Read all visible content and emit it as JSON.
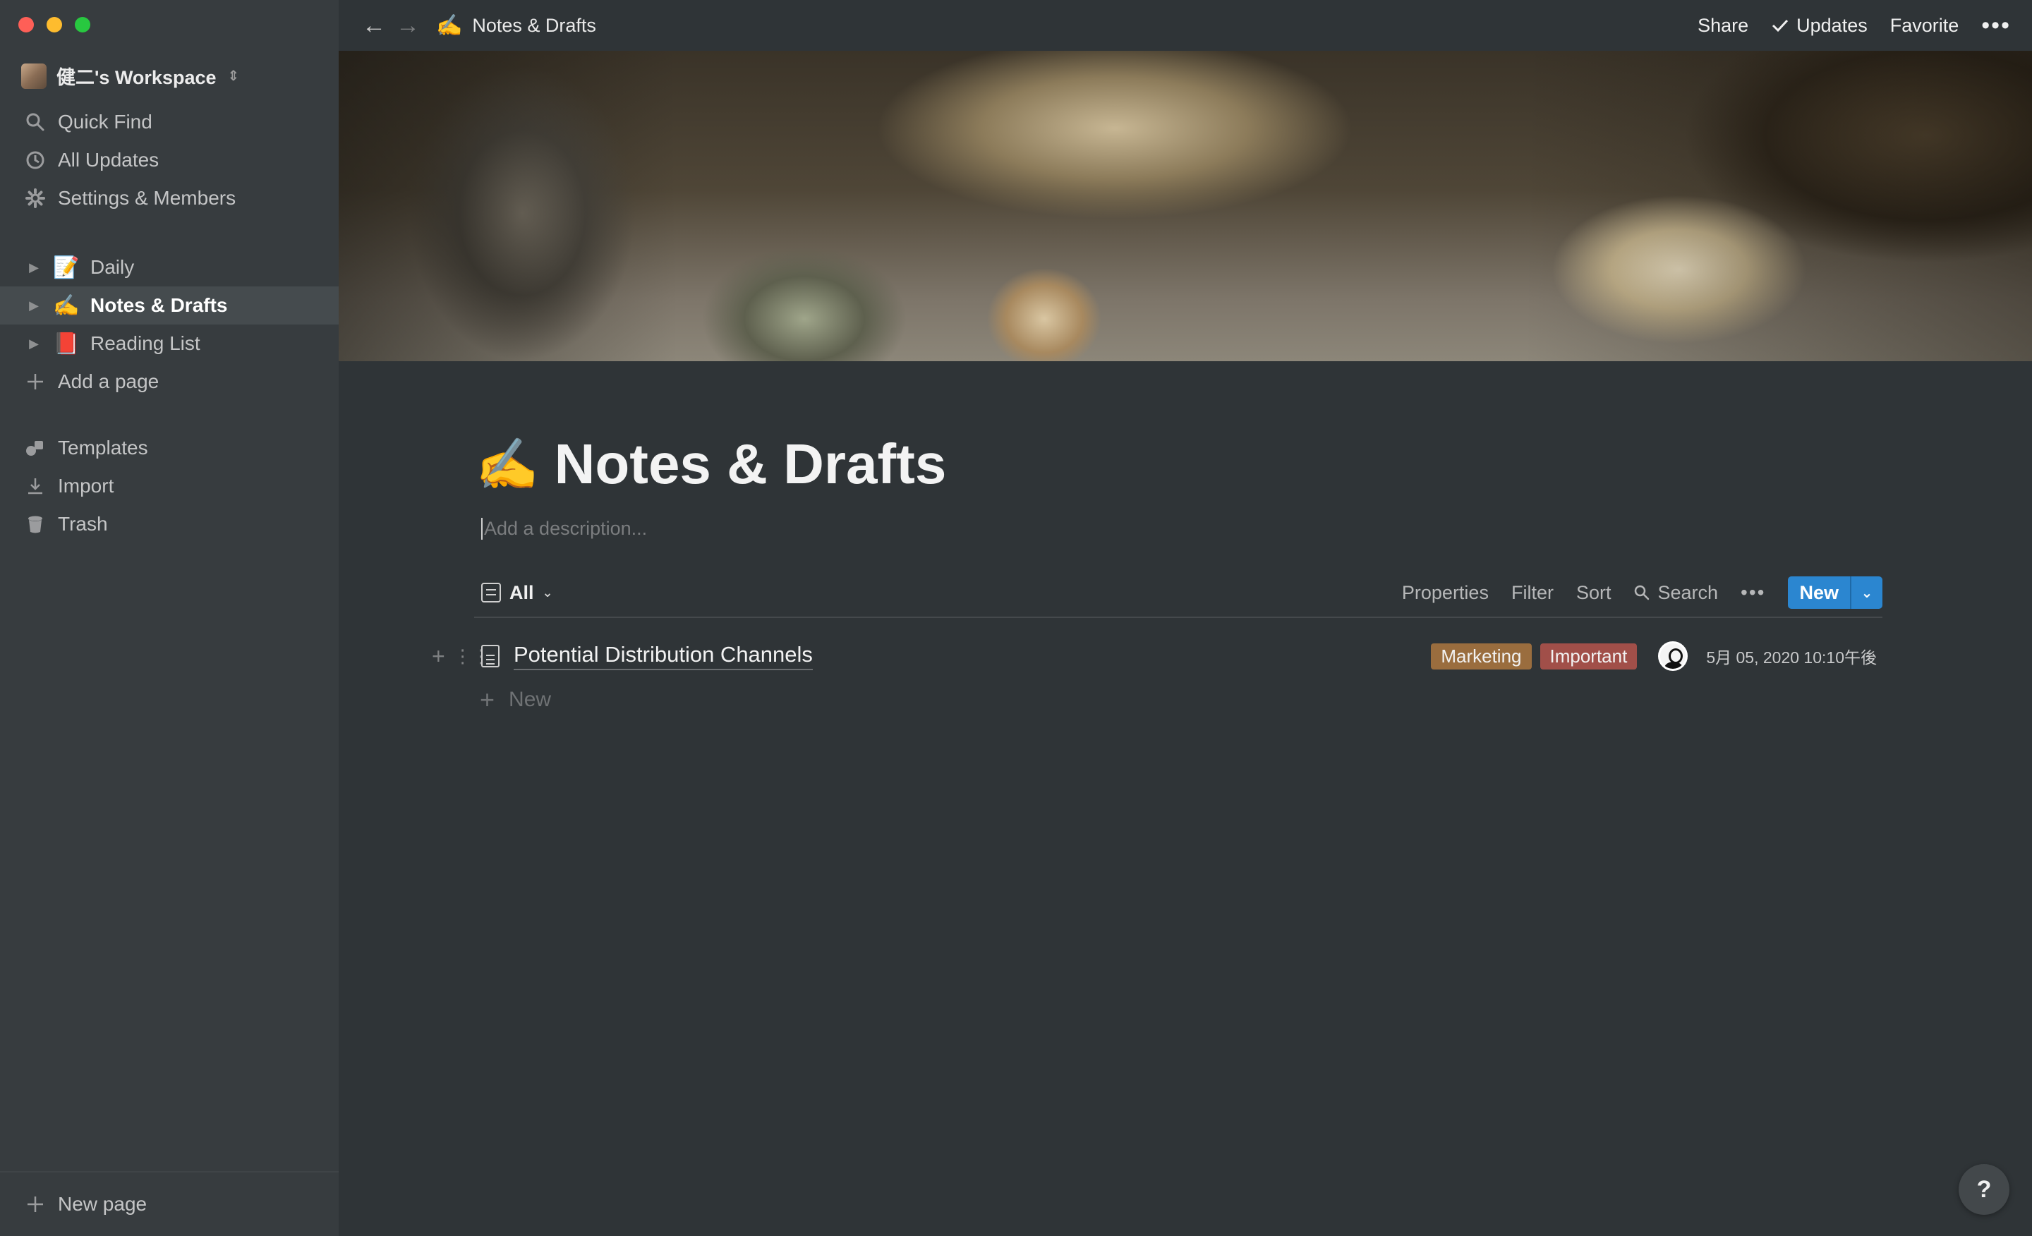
{
  "sidebar": {
    "workspace_name": "健二's Workspace",
    "workspace_chevron": "⌃⌄",
    "nav": [
      {
        "label": "Quick Find",
        "icon": "search-icon"
      },
      {
        "label": "All Updates",
        "icon": "clock-icon"
      },
      {
        "label": "Settings & Members",
        "icon": "gear-icon"
      }
    ],
    "pages": [
      {
        "label": "Daily",
        "emoji": "📝",
        "active": false
      },
      {
        "label": "Notes & Drafts",
        "emoji": "✍️",
        "active": true
      },
      {
        "label": "Reading List",
        "emoji": "📕",
        "active": false
      }
    ],
    "add_page": "Add a page",
    "tools": [
      {
        "label": "Templates",
        "icon": "shapes-icon"
      },
      {
        "label": "Import",
        "icon": "download-icon"
      },
      {
        "label": "Trash",
        "icon": "trash-icon"
      }
    ],
    "new_page": "New page"
  },
  "topbar": {
    "breadcrumb_emoji": "✍️",
    "breadcrumb_title": "Notes & Drafts",
    "share": "Share",
    "updates": "Updates",
    "favorite": "Favorite",
    "more": "•••"
  },
  "page": {
    "emoji": "✍️",
    "title": "Notes & Drafts",
    "description_placeholder": "Add a description..."
  },
  "database": {
    "view_name": "All",
    "actions": {
      "properties": "Properties",
      "filter": "Filter",
      "sort": "Sort",
      "search": "Search",
      "more": "•••",
      "new": "New"
    },
    "rows": [
      {
        "title": "Potential Distribution Channels",
        "tags": [
          {
            "label": "Marketing",
            "color": "#9a6d3e"
          },
          {
            "label": "Important",
            "color": "#a14f49"
          }
        ],
        "created": "5月 05, 2020 10:10午後"
      }
    ],
    "new_row": "New"
  },
  "help": "?",
  "colors": {
    "sidebar_bg": "#373c3f",
    "main_bg": "#2f3437",
    "accent": "#2b86d0"
  }
}
